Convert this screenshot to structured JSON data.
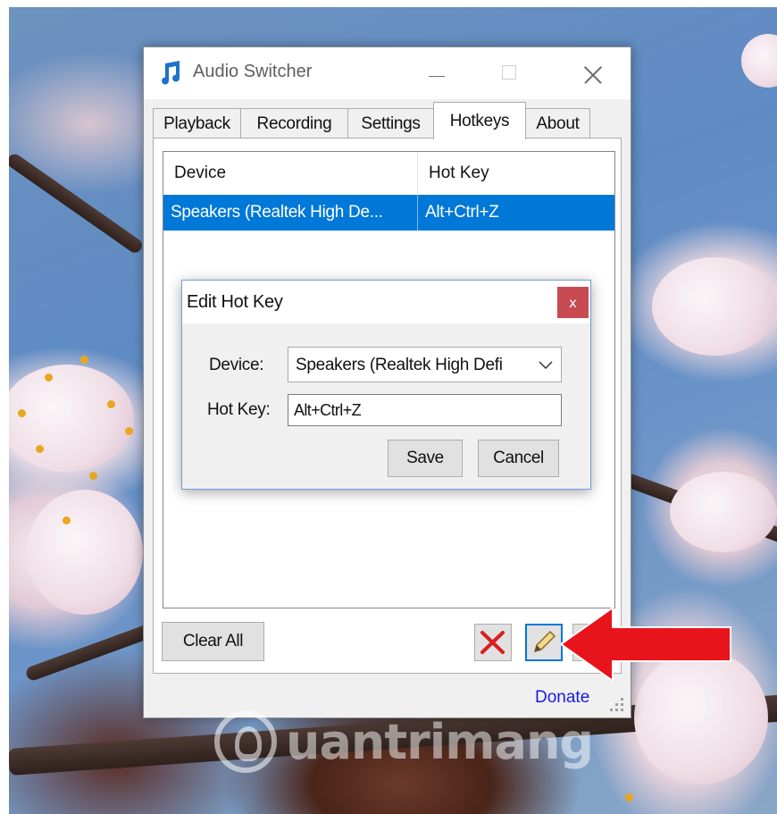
{
  "window": {
    "title": "Audio Switcher"
  },
  "tabs": [
    {
      "label": "Playback",
      "active": false
    },
    {
      "label": "Recording",
      "active": false
    },
    {
      "label": "Settings",
      "active": false
    },
    {
      "label": "Hotkeys",
      "active": true
    },
    {
      "label": "About",
      "active": false
    }
  ],
  "hotkeys_list": {
    "columns": [
      "Device",
      "Hot Key"
    ],
    "rows": [
      {
        "device": "Speakers (Realtek High De...",
        "hotkey": "Alt+Ctrl+Z",
        "selected": true
      }
    ]
  },
  "buttons": {
    "clear_all": "Clear All"
  },
  "footer": {
    "donate": "Donate"
  },
  "dialog": {
    "title": "Edit Hot Key",
    "close_glyph": "x",
    "device_label": "Device:",
    "device_value": "Speakers (Realtek High Defi",
    "hotkey_label": "Hot Key:",
    "hotkey_value": "Alt+Ctrl+Z",
    "save": "Save",
    "cancel": "Cancel"
  },
  "watermark": {
    "text": "uantrimang"
  },
  "colors": {
    "selection": "#0078d7",
    "close_button": "#c74b50",
    "donate_link": "#1a1ae6",
    "arrow": "#e8141b"
  },
  "icons": {
    "app": "music-note-icon",
    "delete": "red-x-icon",
    "edit": "pencil-icon",
    "dropdown": "chevron-down-icon"
  }
}
